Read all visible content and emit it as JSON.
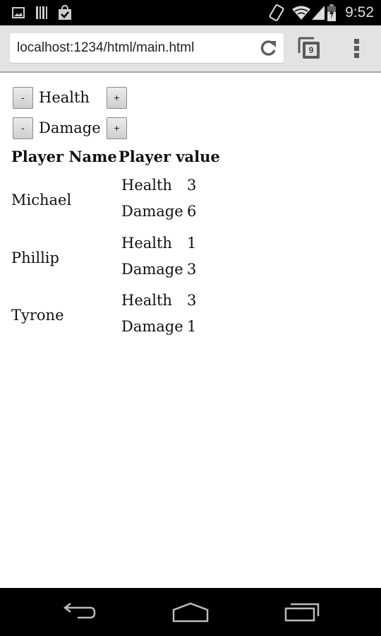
{
  "status_bar": {
    "time": "9:52",
    "left_icons": [
      "gallery-icon",
      "barcode-icon",
      "shopping-bag-check-icon"
    ],
    "right_icons": [
      "rotate-icon",
      "wifi-icon",
      "signal-icon",
      "battery-charging-icon"
    ]
  },
  "browser": {
    "url": "localhost:1234/html/main.html",
    "tab_count": "9",
    "icons": [
      "reload-icon",
      "tabs-icon",
      "overflow-menu-icon"
    ]
  },
  "controls": [
    {
      "label": "Health",
      "minus": "-",
      "plus": "+"
    },
    {
      "label": "Damage",
      "minus": "-",
      "plus": "+"
    }
  ],
  "table": {
    "headers": [
      "Player Name",
      "Player value"
    ],
    "rows": [
      {
        "name": "Michael",
        "stats": [
          {
            "label": "Health",
            "value": "3"
          },
          {
            "label": "Damage",
            "value": "6"
          }
        ]
      },
      {
        "name": "Phillip",
        "stats": [
          {
            "label": "Health",
            "value": "1"
          },
          {
            "label": "Damage",
            "value": "3"
          }
        ]
      },
      {
        "name": "Tyrone",
        "stats": [
          {
            "label": "Health",
            "value": "3"
          },
          {
            "label": "Damage",
            "value": "1"
          }
        ]
      }
    ]
  },
  "nav_bar": {
    "icons": [
      "back-icon",
      "home-icon",
      "recent-apps-icon"
    ]
  }
}
